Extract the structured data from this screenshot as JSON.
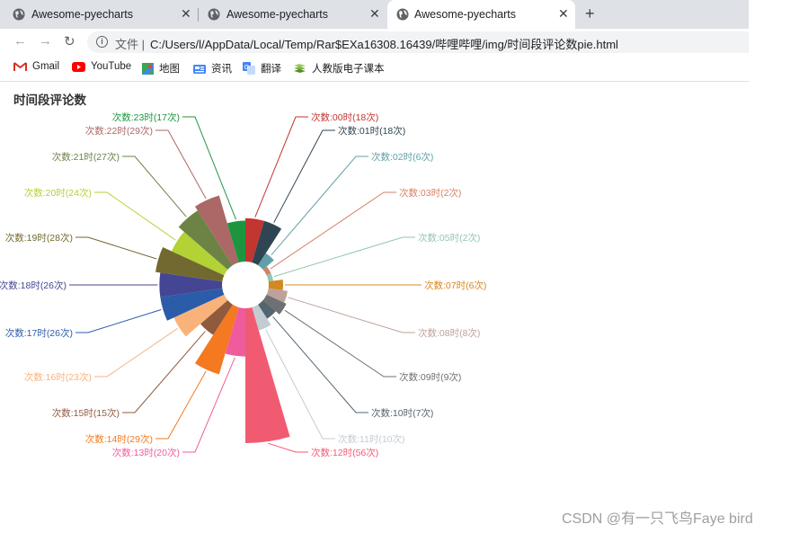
{
  "browser": {
    "tabs": [
      {
        "title": "Awesome-pyecharts",
        "active": false
      },
      {
        "title": "Awesome-pyecharts",
        "active": false
      },
      {
        "title": "Awesome-pyecharts",
        "active": true
      }
    ],
    "close_glyph": "✕",
    "new_tab_glyph": "+",
    "address": {
      "prefix": "文件",
      "url": "C:/Users/l/AppData/Local/Temp/Rar$EXa16308.16439/哔哩哔哩/img/时间段评论数pie.html"
    },
    "bookmarks": [
      {
        "label": "Gmail",
        "icon": "gmail-icon"
      },
      {
        "label": "YouTube",
        "icon": "youtube-icon"
      },
      {
        "label": "地图",
        "icon": "maps-icon"
      },
      {
        "label": "资讯",
        "icon": "news-icon"
      },
      {
        "label": "翻译",
        "icon": "translate-icon"
      },
      {
        "label": "人教版电子课本",
        "icon": "book-icon"
      }
    ]
  },
  "page": {
    "title": "时间段评论数"
  },
  "watermark": "CSDN @有一只飞鸟Faye bird",
  "chart_data": {
    "type": "pie",
    "rose_type": "radius",
    "title": "时间段评论数",
    "label_format": "次数:{hour}({count}次)",
    "slices": [
      {
        "hour": "00时",
        "value": 18,
        "color": "#c23531"
      },
      {
        "hour": "01时",
        "value": 18,
        "color": "#2f4554"
      },
      {
        "hour": "02时",
        "value": 6,
        "color": "#61a0a8"
      },
      {
        "hour": "03时",
        "value": 2,
        "color": "#d48265"
      },
      {
        "hour": "05时",
        "value": 2,
        "color": "#91c7ae"
      },
      {
        "hour": "07时",
        "value": 6,
        "color": "#d48820"
      },
      {
        "hour": "08时",
        "value": 8,
        "color": "#bda29a"
      },
      {
        "hour": "09时",
        "value": 9,
        "color": "#6e7074"
      },
      {
        "hour": "10时",
        "value": 7,
        "color": "#546570"
      },
      {
        "hour": "11时",
        "value": 10,
        "color": "#c4ccd3"
      },
      {
        "hour": "12时",
        "value": 56,
        "color": "#f05b72"
      },
      {
        "hour": "13时",
        "value": 20,
        "color": "#ef5b9c"
      },
      {
        "hour": "14时",
        "value": 29,
        "color": "#f47920"
      },
      {
        "hour": "15时",
        "value": 15,
        "color": "#905a3d"
      },
      {
        "hour": "16时",
        "value": 23,
        "color": "#fab27b"
      },
      {
        "hour": "17时",
        "value": 26,
        "color": "#2a5caa"
      },
      {
        "hour": "18时",
        "value": 26,
        "color": "#444693"
      },
      {
        "hour": "19时",
        "value": 28,
        "color": "#726930"
      },
      {
        "hour": "20时",
        "value": 24,
        "color": "#b2d235"
      },
      {
        "hour": "21时",
        "value": 27,
        "color": "#6d8346"
      },
      {
        "hour": "22时",
        "value": 29,
        "color": "#ac6767"
      },
      {
        "hour": "23时",
        "value": 17,
        "color": "#1d953f"
      }
    ],
    "labels": [
      "次数:00时(18次)",
      "次数:01时(18次)",
      "次数:02时(6次)",
      "次数:03时(2次)",
      "次数:05时(2次)",
      "次数:07时(6次)",
      "次数:08时(8次)",
      "次数:09时(9次)",
      "次数:10时(7次)",
      "次数:11时(10次)",
      "次数:12时(56次)",
      "次数:13时(20次)",
      "次数:14时(29次)",
      "次数:15时(15次)",
      "次数:16时(23次)",
      "次数:17时(26次)",
      "次数:18时(26次)",
      "次数:19时(28次)",
      "次数:20时(24次)",
      "次数:21时(27次)",
      "次数:22时(29次)",
      "次数:23时(17次)"
    ]
  }
}
